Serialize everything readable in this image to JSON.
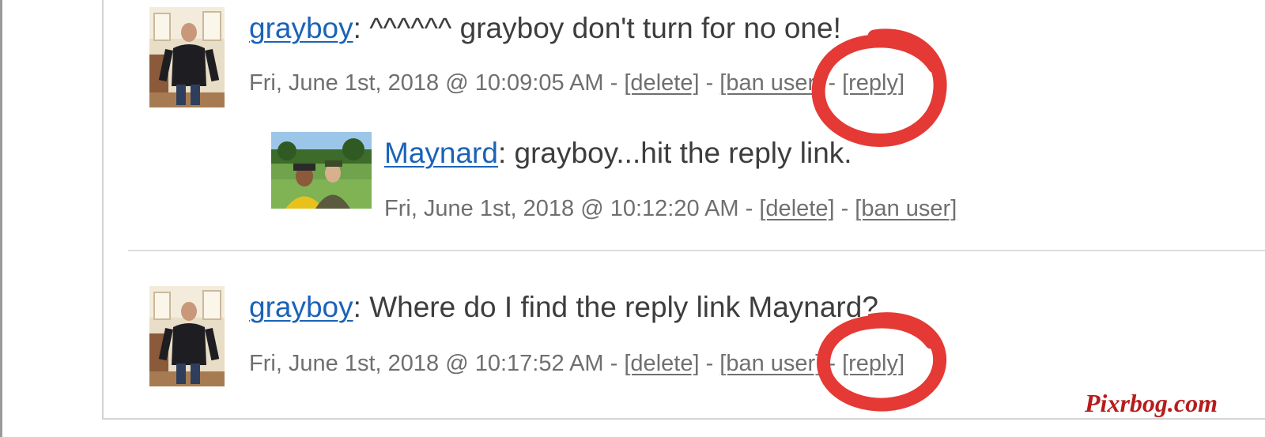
{
  "comments": [
    {
      "author": "grayboy",
      "text": ": ^^^^^^ grayboy don't turn for no one!",
      "timestamp": "Fri, June 1st, 2018 @ 10:09:05 AM",
      "sep1": " - ",
      "delete_label": "[delete]",
      "sep2": " - ",
      "ban_label": "[ban user]",
      "sep3": " - ",
      "reply_label": "[reply]"
    },
    {
      "author": "Maynard",
      "text": ": grayboy...hit the reply link.",
      "timestamp": "Fri, June 1st, 2018 @ 10:12:20 AM",
      "sep1": " - ",
      "delete_label": "[delete]",
      "sep2": " - ",
      "ban_label": "[ban user]"
    },
    {
      "author": "grayboy",
      "text": ": Where do I find the reply link Maynard?",
      "timestamp": "Fri, June 1st, 2018 @ 10:17:52 AM",
      "sep1": " - ",
      "delete_label": "[delete]",
      "sep2": " - ",
      "ban_label": "[ban user]",
      "sep3": " - ",
      "reply_label": "[reply]"
    }
  ],
  "watermark": "Pixrbog.com",
  "colors": {
    "link": "#1a63b8",
    "text": "#3d3d3d",
    "meta": "#6f6f6f",
    "annotation": "#e53935",
    "watermark": "#b71c1c"
  },
  "icons": {
    "annotation": "red-hand-drawn-circle"
  }
}
